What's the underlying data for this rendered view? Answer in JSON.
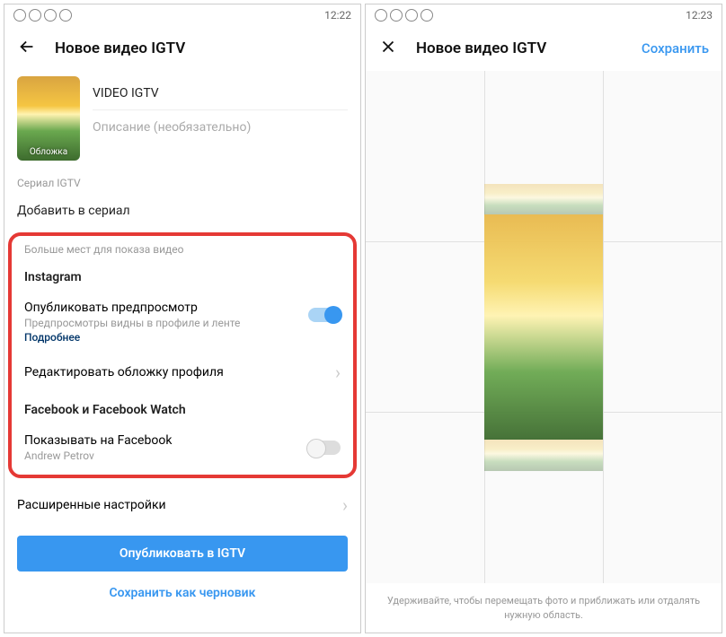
{
  "left": {
    "status_time": "12:22",
    "title": "Новое видео IGTV",
    "thumb_label": "Обложка",
    "video_title": "VIDEO IGTV",
    "desc_placeholder": "Описание (необязательно)",
    "series_label": "Сериал IGTV",
    "add_to_series": "Добавить в сериал",
    "more_places": "Больше мест для показа видео",
    "instagram": "Instagram",
    "preview_label": "Опубликовать предпросмотр",
    "preview_sub": "Предпросмотры видны в профиле и ленте",
    "more_link": "Подробнее",
    "edit_cover": "Редактировать обложку профиля",
    "fb_section": "Facebook и Facebook Watch",
    "fb_show": "Показывать на Facebook",
    "fb_user": "Andrew Petrov",
    "advanced": "Расширенные настройки",
    "publish_btn": "Опубликовать в IGTV",
    "draft_btn": "Сохранить как черновик"
  },
  "right": {
    "status_time": "12:23",
    "title": "Новое видео IGTV",
    "save": "Сохранить",
    "hint": "Удерживайте, чтобы перемещать фото и приближать или отдалять нужную область."
  }
}
